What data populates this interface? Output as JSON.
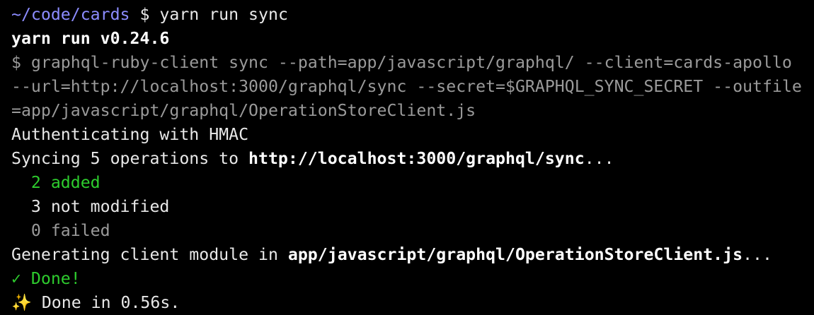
{
  "prompt": {
    "cwd": "~/code/cards",
    "symbol": " $ ",
    "command": "yarn run sync"
  },
  "yarn_header": "yarn run v0.24.6",
  "exec_lines": [
    "$ graphql-ruby-client sync --path=app/javascript/graphql/ --client=cards-apollo",
    "--url=http://localhost:3000/graphql/sync --secret=$GRAPHQL_SYNC_SECRET --outfile",
    "=app/javascript/graphql/OperationStoreClient.js"
  ],
  "auth_line": "Authenticating with HMAC",
  "syncing": {
    "prefix": "Syncing 5 operations to ",
    "url": "http://localhost:3000/graphql/sync",
    "suffix": "..."
  },
  "results": {
    "added": "  2 added",
    "not_modified": "  3 not modified",
    "failed": "  0 failed"
  },
  "generating": {
    "prefix": "Generating client module in ",
    "path": "app/javascript/graphql/OperationStoreClient.js",
    "suffix": "..."
  },
  "done_line": "✓ Done!",
  "finish": {
    "icon": "✨",
    "text": " Done in 0.56s."
  },
  "colors": {
    "background": "#000000",
    "prompt_path": "#8c8cff",
    "dim_text": "#9a9a9a",
    "success": "#2ecc2e"
  }
}
